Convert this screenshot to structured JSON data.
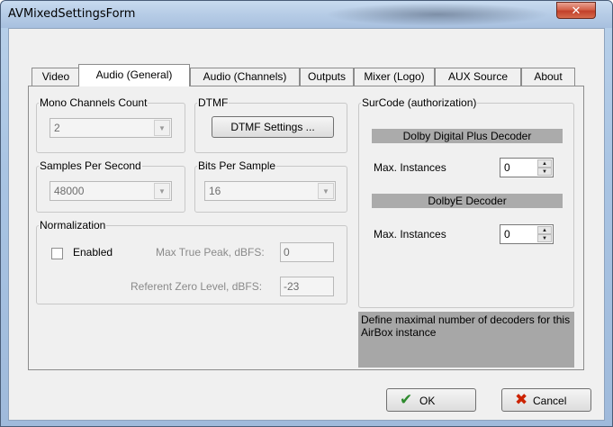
{
  "window": {
    "title": "AVMixedSettingsForm",
    "close_glyph": "✕"
  },
  "tabs": [
    {
      "label": "Video"
    },
    {
      "label": "Audio (General)"
    },
    {
      "label": "Audio (Channels)"
    },
    {
      "label": "Outputs"
    },
    {
      "label": "Mixer (Logo)"
    },
    {
      "label": "AUX Source"
    },
    {
      "label": "About"
    }
  ],
  "mono": {
    "title": "Mono Channels Count",
    "value": "2"
  },
  "dtmf": {
    "title": "DTMF",
    "button": "DTMF Settings ..."
  },
  "samples": {
    "title": "Samples Per Second",
    "value": "48000"
  },
  "bits": {
    "title": "Bits Per Sample",
    "value": "16"
  },
  "normalization": {
    "title": "Normalization",
    "enabled_label": "Enabled",
    "peak_label": "Max True Peak, dBFS:",
    "peak_value": "0",
    "ref_label": "Referent Zero Level, dBFS:",
    "ref_value": "-23"
  },
  "surcode": {
    "title": "SurCode (authorization)",
    "dolby_plus_header": "Dolby Digital Plus Decoder",
    "dolby_plus_label": "Max. Instances",
    "dolby_plus_value": "0",
    "dolby_e_header": "DolbyE Decoder",
    "dolby_e_label": "Max. Instances",
    "dolby_e_value": "0",
    "description": "Define maximal number of decoders for this AirBox instance"
  },
  "footer": {
    "ok_label": "OK",
    "ok_icon": "✔",
    "cancel_label": "Cancel",
    "cancel_icon": "✖"
  },
  "colors": {
    "ok_icon": "#2e8b2e",
    "cancel_icon": "#cc2200",
    "header_bar": "#ababab"
  }
}
